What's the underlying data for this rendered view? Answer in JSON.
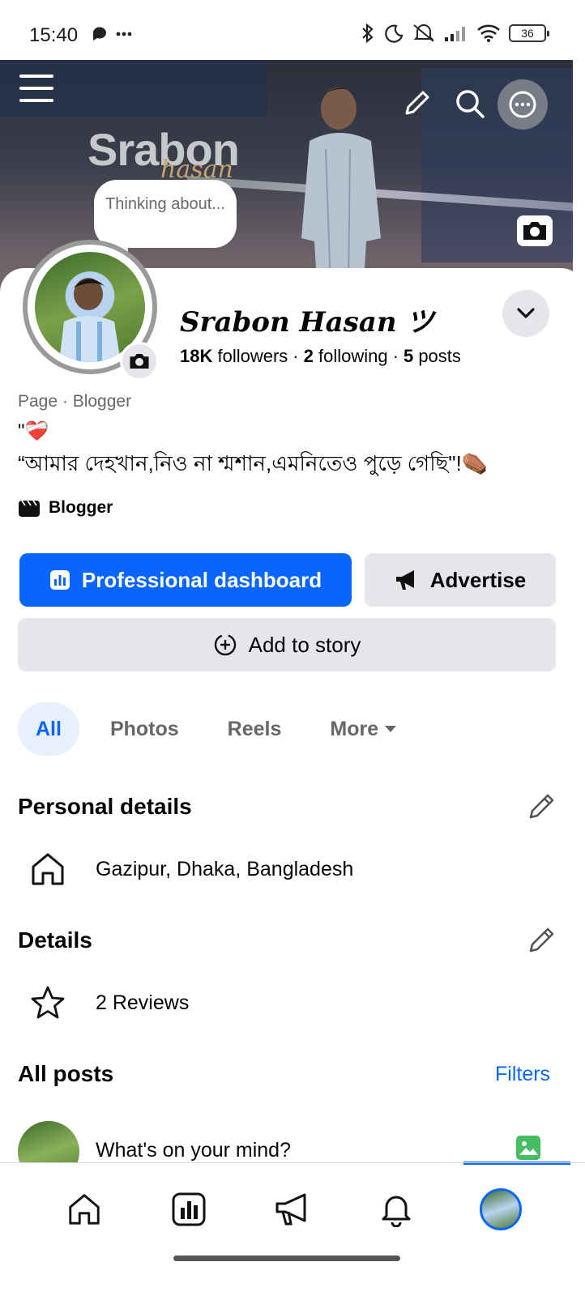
{
  "status_bar": {
    "time": "15:40",
    "left_icons": "messenger-icon more-dots",
    "battery": "36"
  },
  "cover": {
    "brand_main": "Srabon",
    "brand_sub": "hasan",
    "thinking_bubble": "Thinking about...",
    "icons": [
      "menu-icon",
      "pencil-icon",
      "search-icon",
      "more-icon",
      "camera-icon"
    ]
  },
  "profile": {
    "name": "Srabon Hasan ツ",
    "followers_count": "18K",
    "followers_label": "followers",
    "following_count": "2",
    "following_label": "following",
    "posts_count": "5",
    "posts_label": "posts",
    "page_type": "Page · Blogger",
    "bio_line1": "\"❤️‍🩹",
    "bio_line2": "“আমার দেহখান,নিও না শ্মশান,এমনিতেও পুড়ে গেছি\"!⚰️",
    "category": "Blogger"
  },
  "actions": {
    "professional_dashboard": "Professional dashboard",
    "advertise": "Advertise",
    "add_to_story": "Add to story"
  },
  "tabs": [
    {
      "label": "All",
      "active": true
    },
    {
      "label": "Photos",
      "active": false
    },
    {
      "label": "Reels",
      "active": false
    },
    {
      "label": "More",
      "active": false
    }
  ],
  "personal_details": {
    "title": "Personal details",
    "location": "Gazipur, Dhaka, Bangladesh"
  },
  "details": {
    "title": "Details",
    "reviews": "2 Reviews"
  },
  "all_posts": {
    "title": "All posts",
    "filters": "Filters",
    "composer_placeholder": "What's on your mind?"
  },
  "colors": {
    "accent": "#0866ff",
    "button_grey": "#e4e6eb",
    "muted_text": "#65676b",
    "tab_active_bg": "#e7f0fd"
  }
}
